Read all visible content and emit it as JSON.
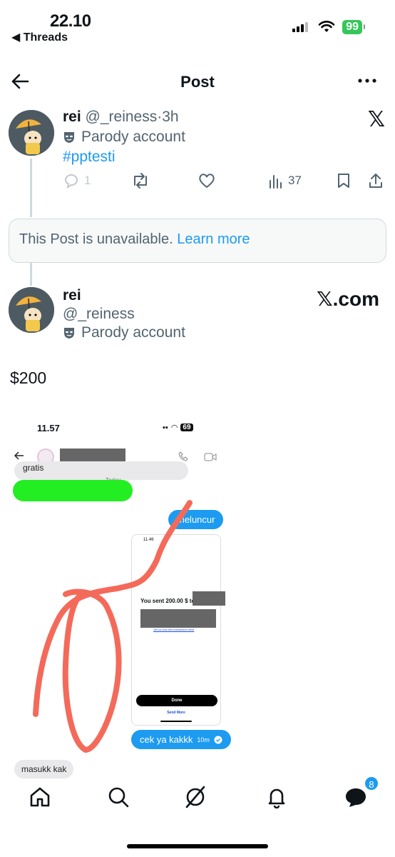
{
  "status_bar": {
    "time": "22.10",
    "back_app": "◀ Threads",
    "battery": "99"
  },
  "header": {
    "title": "Post"
  },
  "post1": {
    "name": "rei",
    "handle": "@_reiness",
    "separator": "·",
    "age": "3h",
    "parody_label": "Parody account",
    "hashtag": "#pptesti",
    "replies": "1",
    "views": "37"
  },
  "unavailable": {
    "text": "This Post is unavailable.",
    "link": "Learn more"
  },
  "post2": {
    "name": "rei",
    "handle": "@_reiness",
    "parody_label": "Parody account",
    "source": "𝕏.com",
    "text": "$200"
  },
  "screenshot": {
    "time": "11.57",
    "battery": "69",
    "grey_bubble_top": "gratis",
    "today": "Today",
    "blue_bubble_1": "meluncur",
    "inner_time": "11.46",
    "inner_sent": "You sent 200.00 $ to",
    "inner_tell": "Tell us how this transaction went",
    "inner_done": "Done",
    "inner_send_more": "Send More",
    "blue_bubble_2": "cek ya kakkk",
    "blue_bubble_2_time": "10m",
    "grey_bubble_bottom": "masukk kak"
  },
  "tabbar": {
    "messages_badge": "8"
  },
  "colors": {
    "accent": "#1d9bf0",
    "green": "#34c759",
    "annotation": "#f46a5a"
  }
}
